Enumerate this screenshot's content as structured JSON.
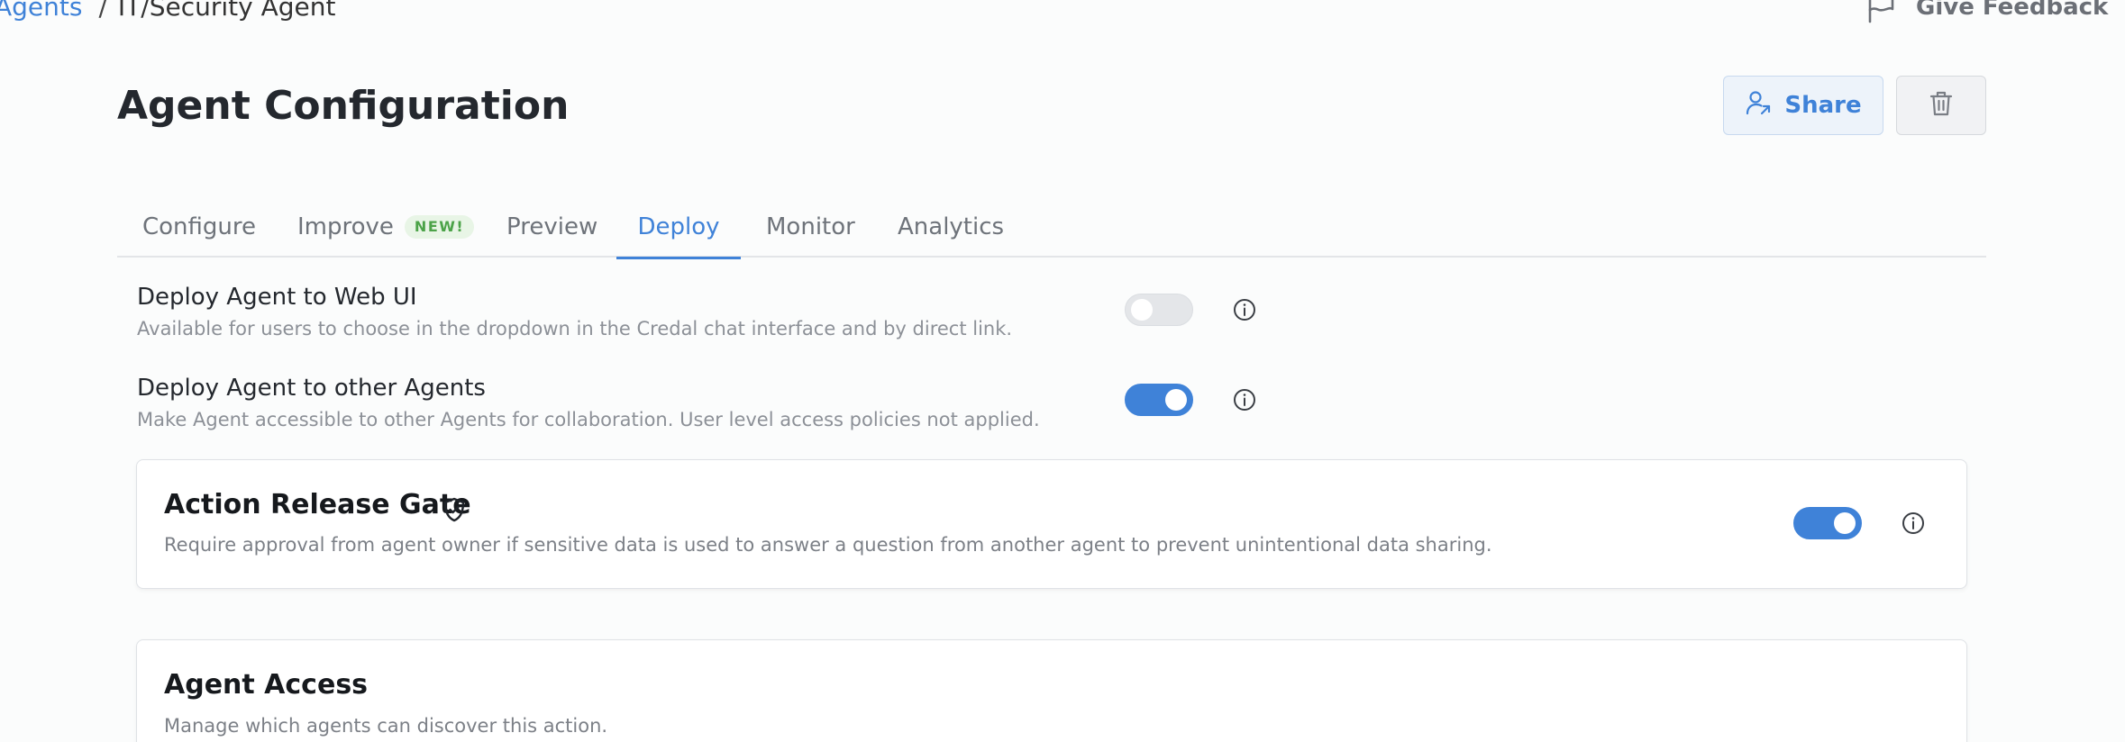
{
  "breadcrumb": {
    "parent": "Agents",
    "separator": "/",
    "current": "IT/Security Agent"
  },
  "header": {
    "feedback_label": "Give Feedback",
    "title": "Agent Configuration",
    "share_label": "Share"
  },
  "tabs": {
    "items": [
      {
        "label": "Configure"
      },
      {
        "label": "Improve",
        "badge": "NEW!"
      },
      {
        "label": "Preview"
      },
      {
        "label": "Deploy"
      },
      {
        "label": "Monitor"
      },
      {
        "label": "Analytics"
      }
    ],
    "active": "Deploy"
  },
  "deploy": {
    "web_ui": {
      "title": "Deploy Agent to Web UI",
      "description": "Available for users to choose in the dropdown in the Credal chat interface and by direct link.",
      "enabled": false
    },
    "other_agents": {
      "title": "Deploy Agent to other Agents",
      "description": "Make Agent accessible to other Agents for collaboration. User level access policies not applied.",
      "enabled": true
    }
  },
  "release_gate": {
    "title": "Action Release Gate",
    "description": "Require approval from agent owner if sensitive data is used to answer a question from another agent to prevent unintentional data sharing.",
    "enabled": true
  },
  "agent_access": {
    "title": "Agent Access",
    "description": "Manage which agents can discover this action."
  },
  "icons": {
    "feedback": "flag-icon",
    "share": "user-share-icon",
    "delete": "trash-icon",
    "info": "info-icon",
    "gate": "shield-check-icon"
  },
  "colors": {
    "accent": "#3f82d8",
    "badge_green": "#4ca349"
  }
}
